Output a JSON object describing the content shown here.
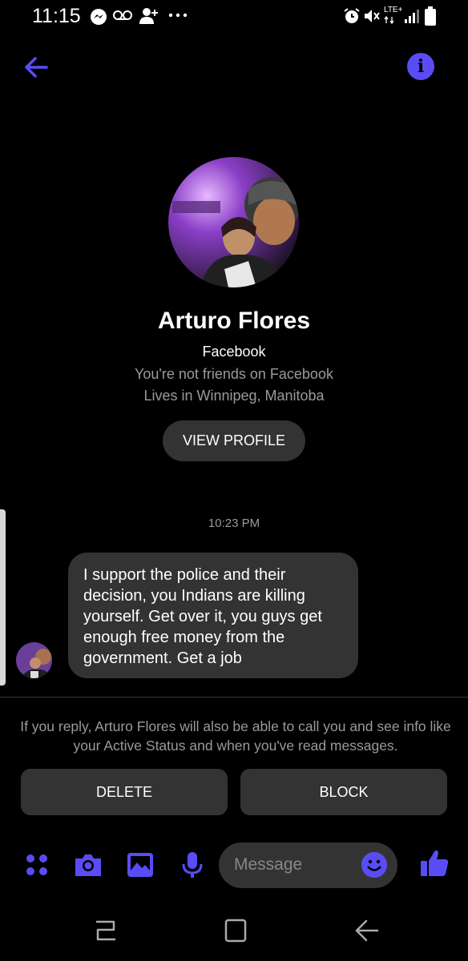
{
  "status_bar": {
    "time": "11:15",
    "network": "LTE+",
    "icons": [
      "messenger-icon",
      "voicemail-icon",
      "add-person-icon",
      "more-icon",
      "alarm-icon",
      "mute-icon",
      "signal-icon",
      "battery-icon"
    ]
  },
  "header": {
    "back_icon": "back-arrow-icon",
    "info_glyph": "i"
  },
  "profile": {
    "name": "Arturo Flores",
    "network": "Facebook",
    "relation": "You're not friends on Facebook",
    "location": "Lives in Winnipeg, Manitoba",
    "view_profile_label": "VIEW PROFILE"
  },
  "conversation": {
    "timestamp": "10:23 PM",
    "message": "I support the police and their decision, you Indians are killing yourself. Get over it, you guys get enough free money from the government. Get a job"
  },
  "request": {
    "notice": "If you reply, Arturo Flores will also be able to call you and see info like your Active Status and when you've read messages.",
    "delete_label": "DELETE",
    "block_label": "BLOCK"
  },
  "composer": {
    "placeholder": "Message",
    "tools": [
      "apps-icon",
      "camera-icon",
      "gallery-icon",
      "microphone-icon"
    ],
    "emoji_icon": "emoji-icon",
    "like_icon": "thumbs-up-icon"
  },
  "colors": {
    "accent": "#5a4cf5",
    "background": "#000000",
    "bubble": "#333333",
    "secondary_text": "#9a9a9a"
  }
}
